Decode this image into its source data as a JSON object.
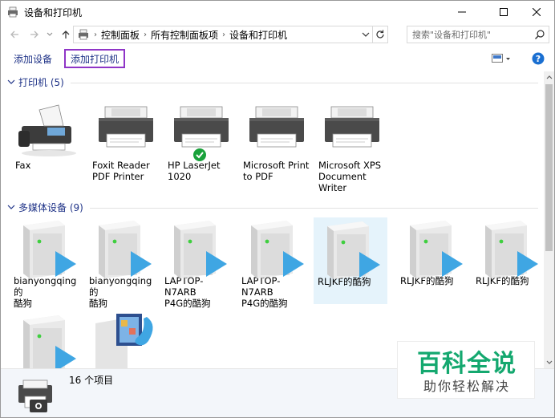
{
  "window": {
    "title": "设备和打印机"
  },
  "address": {
    "crumbs": [
      "控制面板",
      "所有控制面板项",
      "设备和打印机"
    ],
    "search_placeholder": "搜索\"设备和打印机\""
  },
  "toolbar": {
    "add_device_label": "添加设备",
    "add_printer_label": "添加打印机"
  },
  "groups": {
    "printers": {
      "label": "打印机 (5)",
      "items": [
        {
          "name": "Fax",
          "icon": "fax-icon",
          "default": false
        },
        {
          "name": "Foxit Reader\nPDF Printer",
          "icon": "printer-icon",
          "default": false
        },
        {
          "name": "HP LaserJet\n1020",
          "icon": "printer-icon",
          "default": true
        },
        {
          "name": "Microsoft Print\nto PDF",
          "icon": "printer-icon",
          "default": false
        },
        {
          "name": "Microsoft XPS\nDocument\nWriter",
          "icon": "printer-icon",
          "default": false
        }
      ]
    },
    "media": {
      "label": "多媒体设备 (9)",
      "items": [
        {
          "name": "bianyongqing的\n酷狗",
          "icon": "media-server-icon"
        },
        {
          "name": "bianyongqing的\n酷狗",
          "icon": "media-server-icon"
        },
        {
          "name": "LAPTOP-N7ARB\nP4G的酷狗",
          "icon": "media-server-icon"
        },
        {
          "name": "LAPTOP-N7ARB\nP4G的酷狗",
          "icon": "media-server-icon"
        },
        {
          "name": "RLJKF的酷狗",
          "icon": "media-server-icon",
          "selected": true
        },
        {
          "name": "RLJKF的酷狗",
          "icon": "media-server-icon"
        },
        {
          "name": "RLJKF的酷狗",
          "icon": "media-server-icon"
        },
        {
          "name": "",
          "icon": "media-server-icon"
        },
        {
          "name": "",
          "icon": "media-player-icon"
        }
      ]
    }
  },
  "details": {
    "count_text": "16 个项目"
  },
  "watermark": {
    "title": "百科全说",
    "subtitle": "助你轻松解决"
  },
  "colors": {
    "link": "#1e3287",
    "highlight_border": "#8f35c7",
    "selected_bg": "#e5f3fb",
    "check_green": "#19a23b",
    "media_blue": "#3fa6e3",
    "watermark_green": "#14a86f"
  }
}
